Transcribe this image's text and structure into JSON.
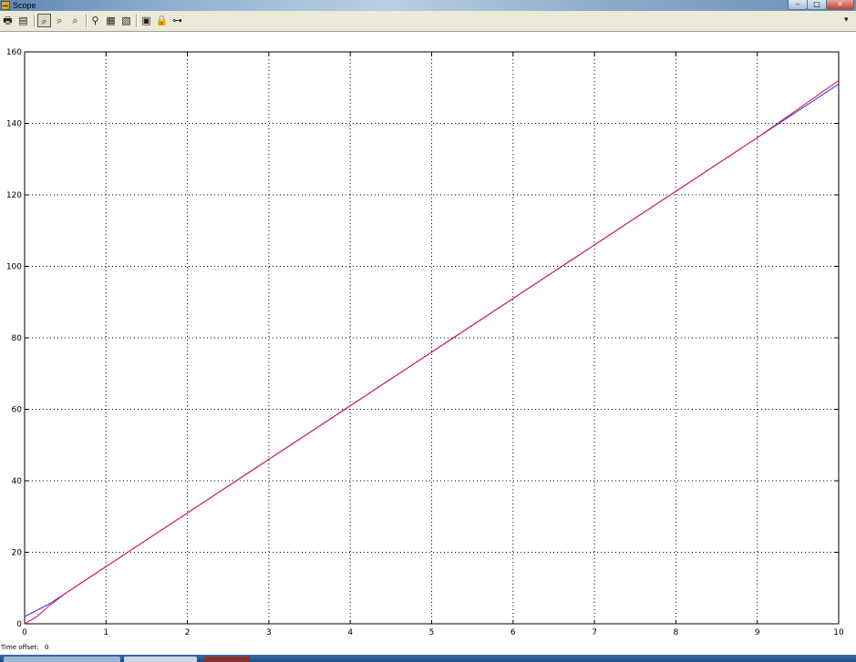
{
  "window": {
    "title": "Scope",
    "minimize_glyph": "–",
    "maximize_glyph": "□",
    "close_glyph": "✕"
  },
  "toolbar": {
    "print_icon": "🖶",
    "params_icon": "▤",
    "zoom_icon": "⌕",
    "zoom_x_icon": "⌕",
    "zoom_y_icon": "⌕",
    "autoscale_icon": "⚲",
    "save_axes_icon": "▦",
    "restore_axes_icon": "▧",
    "floating_icon": "▣",
    "lock_icon": "🔒",
    "signal_select_icon": "⊶",
    "chevron": "▾"
  },
  "status": {
    "time_offset_label": "Time offset:",
    "time_offset_value": "0"
  },
  "colors": {
    "grid": "#000000",
    "series_blue": "#3a3ad8",
    "series_red": "#e0185a"
  },
  "chart_data": {
    "type": "line",
    "title": "",
    "xlabel": "",
    "ylabel": "",
    "xlim": [
      0,
      10
    ],
    "ylim": [
      0,
      160
    ],
    "x_ticks": [
      0,
      1,
      2,
      3,
      4,
      5,
      6,
      7,
      8,
      9,
      10
    ],
    "y_ticks": [
      0,
      20,
      40,
      60,
      80,
      100,
      120,
      140,
      160
    ],
    "grid": true,
    "series": [
      {
        "color": "#3a3ad8",
        "points": [
          [
            0,
            2
          ],
          [
            0.3,
            5.5
          ],
          [
            1,
            16
          ],
          [
            2,
            31
          ],
          [
            3,
            46
          ],
          [
            4,
            61
          ],
          [
            5,
            76
          ],
          [
            6,
            91
          ],
          [
            7,
            106
          ],
          [
            8,
            121
          ],
          [
            9,
            136
          ],
          [
            10,
            151
          ]
        ]
      },
      {
        "color": "#e0185a",
        "points": [
          [
            0,
            0
          ],
          [
            0.15,
            2
          ],
          [
            0.3,
            5
          ],
          [
            0.5,
            8.5
          ],
          [
            1,
            16
          ],
          [
            2,
            31
          ],
          [
            3,
            46
          ],
          [
            4,
            61
          ],
          [
            5,
            76
          ],
          [
            6,
            91
          ],
          [
            7,
            106
          ],
          [
            8,
            121
          ],
          [
            9,
            136
          ],
          [
            10,
            152
          ]
        ]
      }
    ]
  }
}
